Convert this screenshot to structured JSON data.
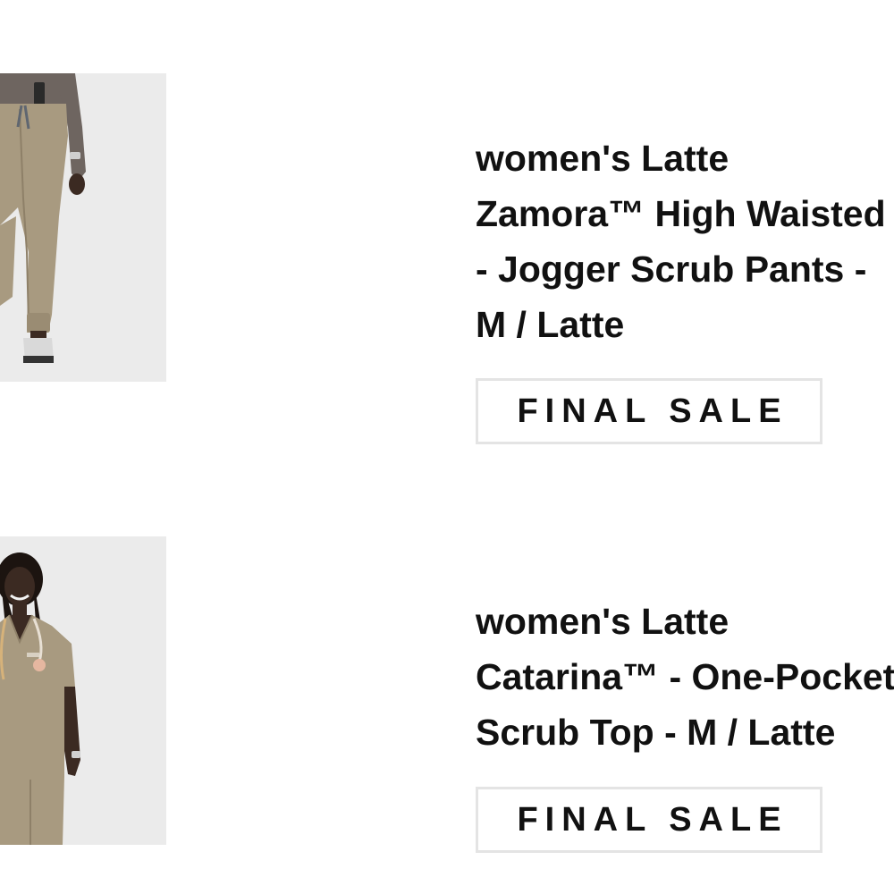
{
  "items": [
    {
      "title_lines": [
        "women's Latte",
        "Zamora™ High Waisted",
        "- Jogger Scrub Pants -",
        "M / Latte"
      ],
      "badge": "FINAL SALE",
      "image": "product-photo-jogger-pants"
    },
    {
      "title_lines": [
        "women's Latte",
        "Catarina™ - One-Pocket",
        "Scrub Top - M / Latte"
      ],
      "badge": "FINAL SALE",
      "image": "product-photo-scrub-top"
    }
  ],
  "colors": {
    "background": "#ffffff",
    "text": "#111111",
    "badge_border": "#e4e4e4",
    "latte": "#a89a80",
    "photo_bg": "#ebebeb"
  }
}
